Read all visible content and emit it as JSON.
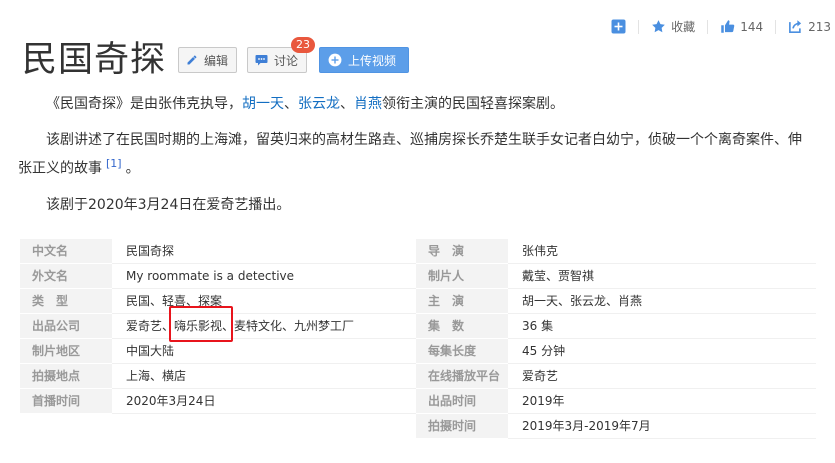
{
  "actions": {
    "add": "",
    "favorite_label": "收藏",
    "like_count": "144",
    "share_count": "213"
  },
  "header": {
    "title": "民国奇探",
    "edit_label": "编辑",
    "discuss_label": "讨论",
    "discuss_badge": "23",
    "upload_label": "上传视频"
  },
  "summary": {
    "p1_start": "《民国奇探》是由张伟克执导，",
    "actor1": "胡一天",
    "sep1": "、",
    "actor2": "张云龙",
    "sep2": "、",
    "actor3": "肖燕",
    "p1_end": "领衔主演的民国轻喜探案剧。",
    "p2_text": "该剧讲述了在民国时期的上海滩，留英归来的高材生路垚、巡捕房探长乔楚生联手女记者白幼宁，侦破一个个离奇案件、伸张正义的故事",
    "p2_ref": "[1]",
    "p2_end": "。",
    "p3": "该剧于2020年3月24日在爱奇艺播出。"
  },
  "info": {
    "left": [
      {
        "key": "中文名",
        "value": "民国奇探"
      },
      {
        "key": "外文名",
        "value": "My roommate is a detective"
      },
      {
        "key": "类　型",
        "value": "民国、轻喜、探案"
      },
      {
        "key": "出品公司",
        "value": "爱奇艺、嗨乐影视、麦特文化、九州梦工厂"
      },
      {
        "key": "制片地区",
        "value": "中国大陆"
      },
      {
        "key": "拍摄地点",
        "value": "上海、横店"
      },
      {
        "key": "首播时间",
        "value": "2020年3月24日"
      }
    ],
    "right": [
      {
        "key": "导　演",
        "value": "张伟克"
      },
      {
        "key": "制片人",
        "value": "戴莹、贾智祺"
      },
      {
        "key": "主　演",
        "value": "胡一天、张云龙、肖燕"
      },
      {
        "key": "集　数",
        "value": "36 集"
      },
      {
        "key": "每集长度",
        "value": "45 分钟"
      },
      {
        "key": "在线播放平台",
        "value": "爱奇艺"
      },
      {
        "key": "出品时间",
        "value": "2019年"
      },
      {
        "key": "拍摄时间",
        "value": "2019年3月-2019年7月"
      }
    ]
  },
  "colors": {
    "link": "#136ec2",
    "upload_button": "#5c9ee9",
    "badge": "#e9583e",
    "highlight_box": "#e8141c",
    "icon_blue": "#4a8fe0"
  }
}
